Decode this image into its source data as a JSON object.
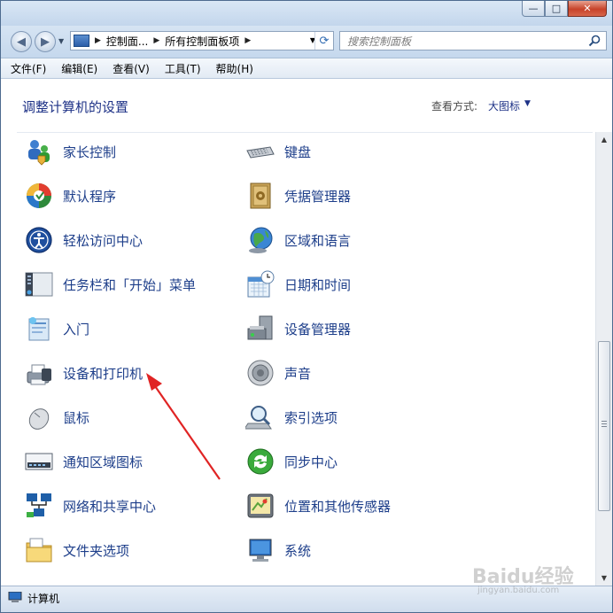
{
  "window": {
    "minimize_glyph": "—",
    "maximize_glyph": "□",
    "close_glyph": "✕"
  },
  "navbar": {
    "back_glyph": "◀",
    "forward_glyph": "▶",
    "address": {
      "crumbs": [
        "控制面...",
        "所有控制面板项"
      ],
      "separator": "▶",
      "refresh_glyph": "⟳"
    },
    "search": {
      "placeholder": "搜索控制面板"
    }
  },
  "menu": [
    "文件(F)",
    "编辑(E)",
    "查看(V)",
    "工具(T)",
    "帮助(H)"
  ],
  "content": {
    "title": "调整计算机的设置",
    "view_label": "查看方式:",
    "view_value": "大图标",
    "left_items": [
      {
        "label": "家长控制",
        "icon": "parental-controls-icon"
      },
      {
        "label": "默认程序",
        "icon": "default-programs-icon"
      },
      {
        "label": "轻松访问中心",
        "icon": "ease-of-access-icon"
      },
      {
        "label": "任务栏和「开始」菜单",
        "icon": "taskbar-icon"
      },
      {
        "label": "入门",
        "icon": "getting-started-icon"
      },
      {
        "label": "设备和打印机",
        "icon": "printer-icon"
      },
      {
        "label": "鼠标",
        "icon": "mouse-icon"
      },
      {
        "label": "通知区域图标",
        "icon": "notification-area-icon"
      },
      {
        "label": "网络和共享中心",
        "icon": "network-icon"
      },
      {
        "label": "文件夹选项",
        "icon": "folder-options-icon"
      }
    ],
    "right_items": [
      {
        "label": "键盘",
        "icon": "keyboard-icon"
      },
      {
        "label": "凭据管理器",
        "icon": "credential-manager-icon"
      },
      {
        "label": "区域和语言",
        "icon": "globe-icon"
      },
      {
        "label": "日期和时间",
        "icon": "calendar-clock-icon"
      },
      {
        "label": "设备管理器",
        "icon": "device-manager-icon"
      },
      {
        "label": "声音",
        "icon": "speaker-icon"
      },
      {
        "label": "索引选项",
        "icon": "indexing-icon"
      },
      {
        "label": "同步中心",
        "icon": "sync-icon"
      },
      {
        "label": "位置和其他传感器",
        "icon": "location-sensor-icon"
      },
      {
        "label": "系统",
        "icon": "system-icon"
      }
    ]
  },
  "status": {
    "text": "计算机"
  },
  "watermark": {
    "text": "Baidu经验",
    "sub": "jingyan.baidu.com"
  },
  "colors": {
    "link": "#1d3e8a",
    "title": "#1e3287",
    "arrow": "#e02424"
  }
}
